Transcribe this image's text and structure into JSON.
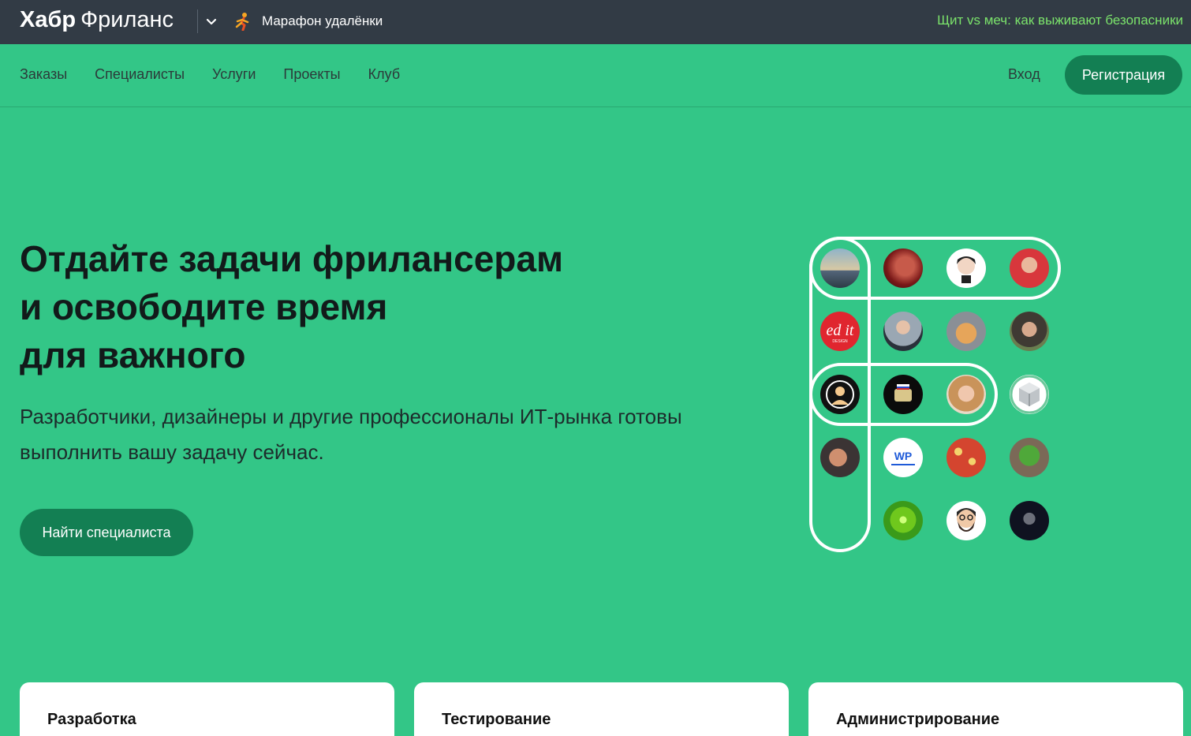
{
  "brand": {
    "name_bold": "Хабр",
    "name_light": "Фриланс"
  },
  "topbar": {
    "promo_label": "Марафон удалёнки",
    "news_link": "Щит vs меч: как выживают безопасники"
  },
  "nav": {
    "items": [
      {
        "label": "Заказы"
      },
      {
        "label": "Специалисты"
      },
      {
        "label": "Услуги"
      },
      {
        "label": "Проекты"
      },
      {
        "label": "Клуб"
      }
    ],
    "login": "Вход",
    "register": "Регистрация"
  },
  "hero": {
    "title_lines": [
      "Отдайте задачи фрилансерам",
      "и освободите время",
      "для важного"
    ],
    "subtitle": "Разработчики, дизайнеры и другие профессионалы ИТ-рынка готовы выполнить вашу задачу сейчас.",
    "cta": "Найти специалиста"
  },
  "categories": [
    {
      "label": "Разработка"
    },
    {
      "label": "Тестирование"
    },
    {
      "label": "Администрирование"
    }
  ],
  "colors": {
    "accent": "#33c687",
    "button": "#137f53",
    "topbar": "#323b45",
    "news_link": "#7be36b"
  }
}
